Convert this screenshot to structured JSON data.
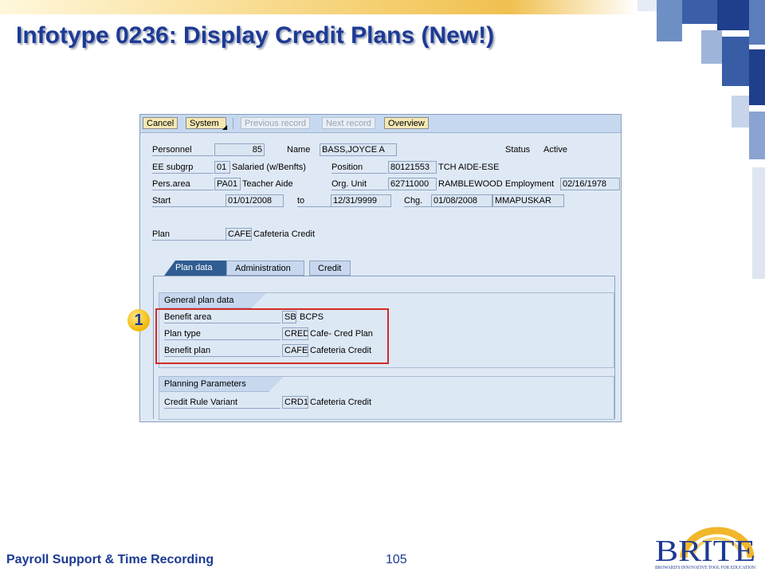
{
  "slide": {
    "title": "Infotype 0236: Display Credit Plans (New!)",
    "footer_left": "Payroll Support & Time Recording",
    "page_number": "105",
    "callout_number": "1"
  },
  "logo": {
    "text": "BRITE",
    "tagline": "BROWARD'S INNOVATIVE TOOL FOR EDUCATION"
  },
  "toolbar": {
    "cancel": "Cancel",
    "system": "System",
    "previous_record": "Previous record",
    "next_record": "Next record",
    "overview": "Overview"
  },
  "header": {
    "personnel_label": "Personnel",
    "personnel_value": "85",
    "name_label": "Name",
    "name_value": "BASS,JOYCE A",
    "status_label": "Status",
    "status_value": "Active",
    "ee_subgrp_label": "EE subgrp",
    "ee_subgrp_code": "01",
    "ee_subgrp_text": "Salaried (w/Benfts)",
    "position_label": "Position",
    "position_code": "80121553",
    "position_text": "TCH AIDE-ESE",
    "pers_area_label": "Pers.area",
    "pers_area_code": "PA01",
    "pers_area_text": "Teacher Aide",
    "org_unit_label": "Org. Unit",
    "org_unit_code": "62711000",
    "org_unit_text": "RAMBLEWOOD",
    "employment_label": "Employment",
    "employment_date": "02/16/1978",
    "start_label": "Start",
    "start_value": "01/01/2008",
    "to_label": "to",
    "to_value": "12/31/9999",
    "chg_label": "Chg.",
    "chg_date": "01/08/2008",
    "chg_user": "MMAPUSKAR",
    "plan_label": "Plan",
    "plan_code": "CAFE",
    "plan_text": "Cafeteria Credit"
  },
  "tabs": [
    "Plan data",
    "Administration",
    "Credit"
  ],
  "general_plan_data": {
    "title": "General plan data",
    "benefit_area_label": "Benefit area",
    "benefit_area_code": "SB",
    "benefit_area_text": "BCPS",
    "plan_type_label": "Plan type",
    "plan_type_code": "CRED",
    "plan_type_text": "Cafe- Cred Plan",
    "benefit_plan_label": "Benefit plan",
    "benefit_plan_code": "CAFE",
    "benefit_plan_text": "Cafeteria Credit"
  },
  "planning_parameters": {
    "title": "Planning Parameters",
    "credit_rule_label": "Credit Rule Variant",
    "credit_rule_code": "CRD1",
    "credit_rule_text": "Cafeteria Credit"
  },
  "colors": {
    "title_blue": "#1d3a94",
    "highlight_red": "#d42a2a",
    "tab_active": "#2f5d92"
  }
}
